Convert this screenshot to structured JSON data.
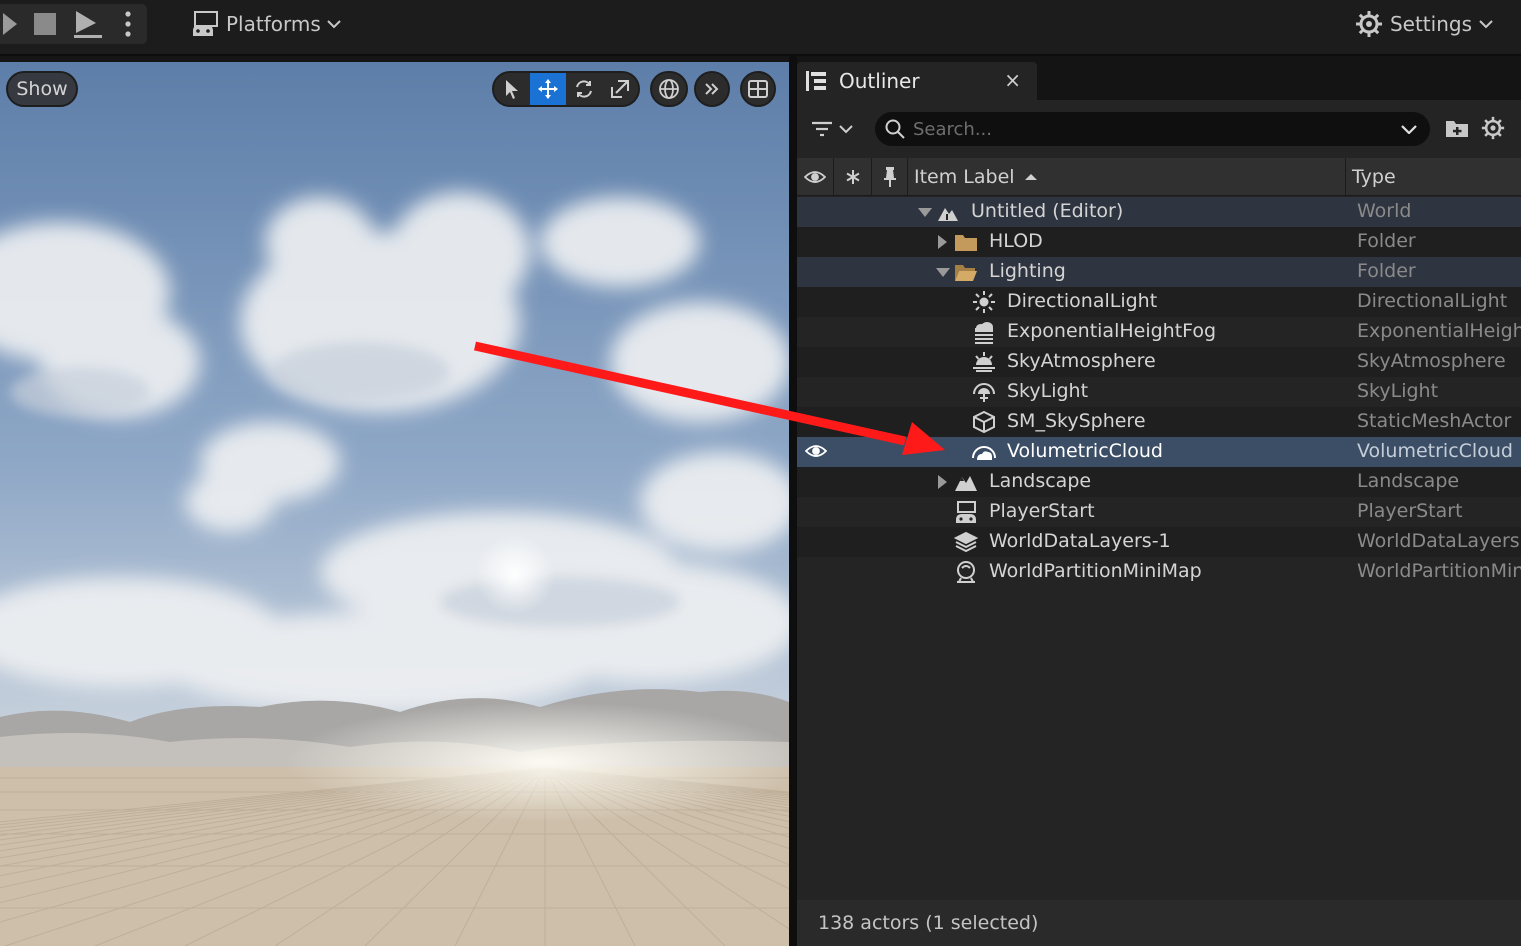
{
  "toolbar": {
    "play_icon": "play-icon",
    "stop_icon": "stop-icon",
    "eject_icon": "eject-icon",
    "more_icon": "kebab-menu-icon",
    "platforms_label": "Platforms",
    "settings_label": "Settings"
  },
  "viewport": {
    "show_label": "Show",
    "tools": [
      "select-icon",
      "translate-icon",
      "rotate-icon",
      "scale-icon"
    ],
    "active_tool": "translate-icon",
    "colors": {
      "sky_top": "#5f7fa8",
      "sky_mid": "#8aa4c8",
      "ground": "#c9b9a3",
      "active_button": "#1a73d4"
    }
  },
  "outliner": {
    "tab_title": "Outliner",
    "close_label": "×",
    "search_placeholder": "Search...",
    "header": {
      "item_label": "Item Label",
      "type": "Type"
    },
    "rows": [
      {
        "label": "Untitled (Editor)",
        "type": "World",
        "icon": "world-icon",
        "expanded": true
      },
      {
        "label": "HLOD",
        "type": "Folder",
        "icon": "folder-icon",
        "expanded": false
      },
      {
        "label": "Lighting",
        "type": "Folder",
        "icon": "folder-open-icon",
        "expanded": true
      },
      {
        "label": "DirectionalLight",
        "type": "DirectionalLight",
        "icon": "directional-light-icon"
      },
      {
        "label": "ExponentialHeightFog",
        "type": "ExponentialHeightF",
        "icon": "height-fog-icon"
      },
      {
        "label": "SkyAtmosphere",
        "type": "SkyAtmosphere",
        "icon": "sky-atmosphere-icon"
      },
      {
        "label": "SkyLight",
        "type": "SkyLight",
        "icon": "sky-light-icon"
      },
      {
        "label": "SM_SkySphere",
        "type": "StaticMeshActor",
        "icon": "static-mesh-icon"
      },
      {
        "label": "VolumetricCloud",
        "type": "VolumetricCloud",
        "icon": "volumetric-cloud-icon",
        "selected": true
      },
      {
        "label": "Landscape",
        "type": "Landscape",
        "icon": "landscape-icon",
        "expanded": false
      },
      {
        "label": "PlayerStart",
        "type": "PlayerStart",
        "icon": "player-start-icon"
      },
      {
        "label": "WorldDataLayers-1",
        "type": "WorldDataLayers",
        "icon": "data-layers-icon"
      },
      {
        "label": "WorldPartitionMiniMap",
        "type": "WorldPartitionMini",
        "icon": "minimap-icon"
      }
    ],
    "status": "138 actors (1 selected)",
    "colors": {
      "selected_row": "#3b4e66",
      "annotation_arrow": "#ff1a1a"
    }
  }
}
